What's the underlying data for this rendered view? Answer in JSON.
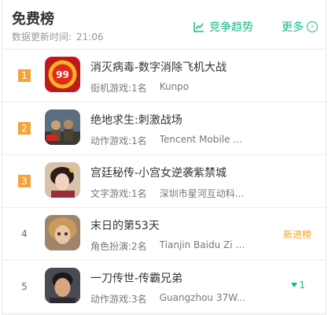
{
  "header": {
    "title": "免费榜",
    "update_label": "数据更新时间:",
    "update_time": "21:06",
    "trend_label": "竞争趋势",
    "more_label": "更多",
    "accent": "#18b889"
  },
  "rows": [
    {
      "rank": "1",
      "name": "消灭病毒-数字消除飞机大战",
      "category": "街机游戏:1名",
      "developer": "Kunpo",
      "icon": "virus-game-icon",
      "badge": ""
    },
    {
      "rank": "2",
      "name": "绝地求生:刺激战场",
      "category": "动作游戏:1名",
      "developer": "Tencent Mobile G...",
      "icon": "pubg-icon",
      "badge": ""
    },
    {
      "rank": "3",
      "name": "宫廷秘传-小宫女逆袭紫禁城",
      "category": "文字游戏:1名",
      "developer": "深圳市星河互动科...",
      "icon": "palace-icon",
      "badge": ""
    },
    {
      "rank": "4",
      "name": "末日的第53天",
      "category": "角色扮演:2名",
      "developer": "Tianjin Baidu Zi T...",
      "icon": "doll-icon",
      "badge": "新进榜"
    },
    {
      "rank": "5",
      "name": "一刀传世-传霸兄弟",
      "category": "动作游戏:3名",
      "developer": "Guangzhou 37W...",
      "icon": "jackie-icon",
      "badge_down": "1"
    }
  ]
}
